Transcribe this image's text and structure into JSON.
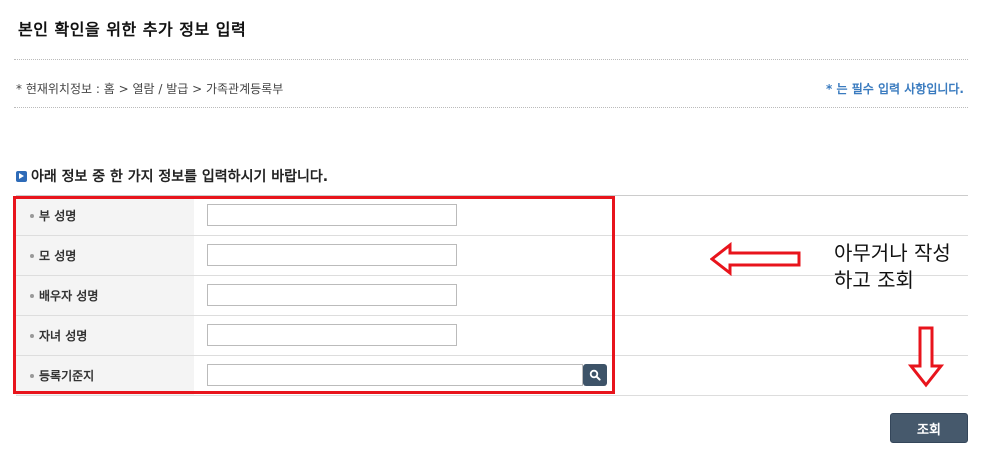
{
  "page": {
    "title": "본인 확인을 위한 추가 정보 입력",
    "location": "* 현재위치정보 : 홈 > 열람 / 발급 > 가족관계등록부",
    "required_note": "* 는 필수 입력 사항입니다."
  },
  "form": {
    "section_title": "아래 정보 중 한 가지 정보를 입력하시기 바랍니다.",
    "fields": [
      {
        "label": "부 성명",
        "value": ""
      },
      {
        "label": "모 성명",
        "value": ""
      },
      {
        "label": "배우자 성명",
        "value": ""
      },
      {
        "label": "자녀 성명",
        "value": ""
      },
      {
        "label": "등록기준지",
        "value": ""
      }
    ],
    "search_icon": "search-icon",
    "submit_label": "조회"
  },
  "annotation": {
    "note_line1": "아무거나 작성",
    "note_line2": "하고 조회",
    "frame_color": "#e8141c"
  },
  "colors": {
    "accent": "#2e6bb8",
    "button": "#46596c",
    "required_text": "#3a7bbf"
  }
}
